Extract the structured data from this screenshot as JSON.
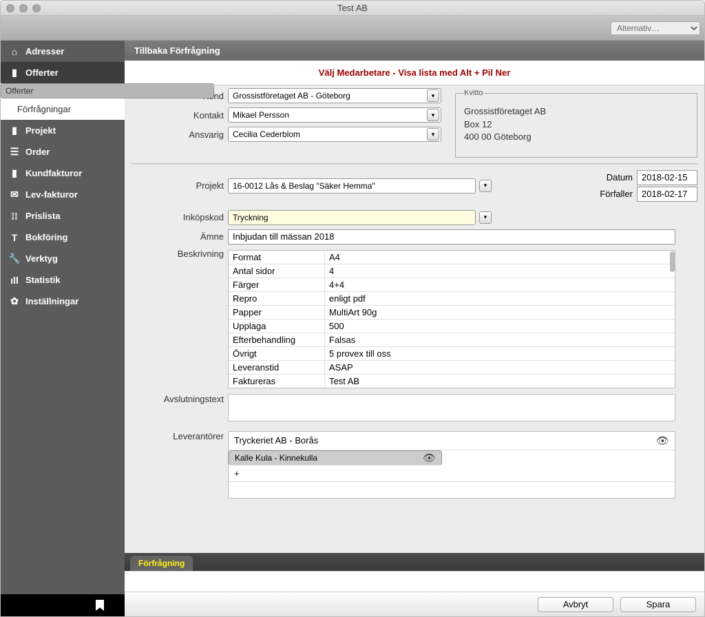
{
  "window": {
    "title": "Test AB"
  },
  "toolbar": {
    "alt_label": "Alternativ…"
  },
  "sidebar": {
    "items": [
      {
        "label": "Adresser"
      },
      {
        "label": "Offerter"
      },
      {
        "label": "Projekt"
      },
      {
        "label": "Order"
      },
      {
        "label": "Kundfakturor"
      },
      {
        "label": "Lev-fakturor"
      },
      {
        "label": "Prislista"
      },
      {
        "label": "Bokföring"
      },
      {
        "label": "Verktyg"
      },
      {
        "label": "Statistik"
      },
      {
        "label": "Inställningar"
      }
    ],
    "sub": [
      {
        "label": "Offerter"
      },
      {
        "label": "Förfrågningar"
      }
    ]
  },
  "crumb": "Tillbaka Förfrågning",
  "hint": "Välj Medarbetare - Visa lista med Alt + Pil Ner",
  "form": {
    "kund_lbl": "Kund",
    "kund": "Grossistföretaget AB  - Göteborg",
    "kontakt_lbl": "Kontakt",
    "kontakt": "Mikael Persson",
    "ansvarig_lbl": "Ansvarig",
    "ansvarig": "Cecilia Cederblom",
    "kvitto_legend": "Kvitto",
    "kvitto_name": "Grossistföretaget AB",
    "kvitto_addr": "Box 12",
    "kvitto_city": "400 00   Göteborg",
    "projekt_lbl": "Projekt",
    "projekt": "16-0012 Lås & Beslag \"Säker Hemma\"",
    "datum_lbl": "Datum",
    "datum": "2018-02-15",
    "forfaller_lbl": "Förfaller",
    "forfaller": "2018-02-17",
    "inkopskod_lbl": "Inköpskod",
    "inkopskod": "Tryckning",
    "amne_lbl": "Ämne",
    "amne": "Inbjudan till mässan 2018",
    "beskrivning_lbl": "Beskrivning",
    "avslut_lbl": "Avslutningstext",
    "lev_lbl": "Leverantörer",
    "desc": [
      {
        "k": "Format",
        "v": "A4"
      },
      {
        "k": "Antal sidor",
        "v": "4"
      },
      {
        "k": "Färger",
        "v": "4+4"
      },
      {
        "k": "Repro",
        "v": "enligt pdf"
      },
      {
        "k": "Papper",
        "v": "MultiArt 90g"
      },
      {
        "k": "Upplaga",
        "v": "500"
      },
      {
        "k": "Efterbehandling",
        "v": "Falsas"
      },
      {
        "k": "Övrigt",
        "v": "5 provex till oss"
      },
      {
        "k": "Leveranstid",
        "v": "ASAP"
      },
      {
        "k": "Faktureras",
        "v": "Test AB"
      }
    ],
    "lev": [
      "Tryckeriet AB  - Borås",
      "Kalle Kula  - Kinnekulla",
      "+"
    ]
  },
  "tab": "Förfrågning",
  "footer": {
    "avbryt": "Avbryt",
    "spara": "Spara"
  }
}
